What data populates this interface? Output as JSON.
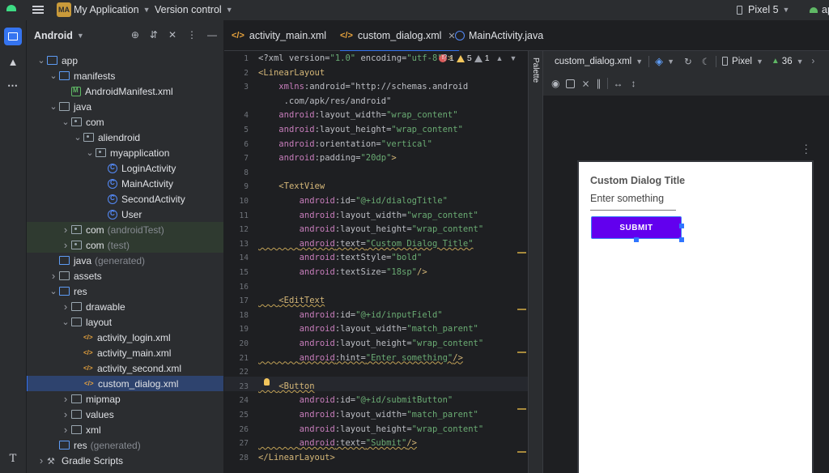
{
  "titlebar": {
    "project_badge": "MA",
    "project_name": "My Application",
    "vcs": "Version control",
    "device": "Pixel 5",
    "run_config": "app"
  },
  "project_panel": {
    "view_mode": "Android",
    "tree": [
      {
        "label": "app",
        "extra": "",
        "icon": "folder-module"
      },
      {
        "label": "manifests",
        "extra": "",
        "icon": "folder"
      },
      {
        "label": "AndroidManifest.xml",
        "extra": "",
        "icon": "manifest"
      },
      {
        "label": "java",
        "extra": "",
        "icon": "folder"
      },
      {
        "label": "com",
        "extra": "",
        "icon": "package"
      },
      {
        "label": "aliendroid",
        "extra": "",
        "icon": "package"
      },
      {
        "label": "myapplication",
        "extra": "",
        "icon": "package"
      },
      {
        "label": "LoginActivity",
        "extra": "",
        "icon": "class"
      },
      {
        "label": "MainActivity",
        "extra": "",
        "icon": "class"
      },
      {
        "label": "SecondActivity",
        "extra": "",
        "icon": "class"
      },
      {
        "label": "User",
        "extra": "",
        "icon": "class"
      },
      {
        "label": "com",
        "extra": "(androidTest)",
        "icon": "package"
      },
      {
        "label": "com",
        "extra": "(test)",
        "icon": "package"
      },
      {
        "label": "java",
        "extra": "(generated)",
        "icon": "folder"
      },
      {
        "label": "assets",
        "extra": "",
        "icon": "folder"
      },
      {
        "label": "res",
        "extra": "",
        "icon": "folder"
      },
      {
        "label": "drawable",
        "extra": "",
        "icon": "folder"
      },
      {
        "label": "layout",
        "extra": "",
        "icon": "folder"
      },
      {
        "label": "activity_login.xml",
        "extra": "",
        "icon": "xml"
      },
      {
        "label": "activity_main.xml",
        "extra": "",
        "icon": "xml"
      },
      {
        "label": "activity_second.xml",
        "extra": "",
        "icon": "xml"
      },
      {
        "label": "custom_dialog.xml",
        "extra": "",
        "icon": "xml"
      },
      {
        "label": "mipmap",
        "extra": "",
        "icon": "folder"
      },
      {
        "label": "values",
        "extra": "",
        "icon": "folder"
      },
      {
        "label": "xml",
        "extra": "",
        "icon": "folder"
      },
      {
        "label": "res",
        "extra": "(generated)",
        "icon": "folder"
      },
      {
        "label": "Gradle Scripts",
        "extra": "",
        "icon": "gradle"
      }
    ]
  },
  "tabs": [
    {
      "label": "activity_main.xml",
      "type": "xml"
    },
    {
      "label": "custom_dialog.xml",
      "type": "xml",
      "active": true
    },
    {
      "label": "MainActivity.java",
      "type": "class"
    }
  ],
  "inspections": {
    "errors": "1",
    "warnings": "5",
    "weak_warnings": "1"
  },
  "editor": {
    "line_numbers": [
      "1",
      "2",
      "3",
      "",
      "4",
      "5",
      "6",
      "7",
      "8",
      "9",
      "10",
      "11",
      "12",
      "13",
      "14",
      "15",
      "16",
      "17",
      "18",
      "19",
      "20",
      "21",
      "22",
      "23",
      "24",
      "25",
      "26",
      "27",
      "28"
    ],
    "lines": [
      "<?xml version=\"1.0\" encoding=\"utf-8\"?>",
      "<LinearLayout",
      "    xmlns:android=\"http://schemas.android",
      "     .com/apk/res/android\"",
      "    android:layout_width=\"wrap_content\"",
      "    android:layout_height=\"wrap_content\"",
      "    android:orientation=\"vertical\"",
      "    android:padding=\"20dp\">",
      "",
      "    <TextView",
      "        android:id=\"@+id/dialogTitle\"",
      "        android:layout_width=\"wrap_content\"",
      "        android:layout_height=\"wrap_content\"",
      "        android:text=\"Custom Dialog Title\"",
      "        android:textStyle=\"bold\"",
      "        android:textSize=\"18sp\"/>",
      "",
      "    <EditText",
      "        android:id=\"@+id/inputField\"",
      "        android:layout_width=\"match_parent\"",
      "        android:layout_height=\"wrap_content\"",
      "        android:hint=\"Enter something\"/>",
      "",
      "    <Button",
      "        android:id=\"@+id/submitButton\"",
      "        android:layout_width=\"match_parent\"",
      "        android:layout_height=\"wrap_content\"",
      "        android:text=\"Submit\"/>",
      "</LinearLayout>"
    ]
  },
  "palette_label": "Palette",
  "design": {
    "file": "custom_dialog.xml",
    "device": "Pixel",
    "api": "36",
    "preview": {
      "title": "Custom Dialog Title",
      "hint": "Enter something",
      "button": "SUBMIT"
    }
  }
}
